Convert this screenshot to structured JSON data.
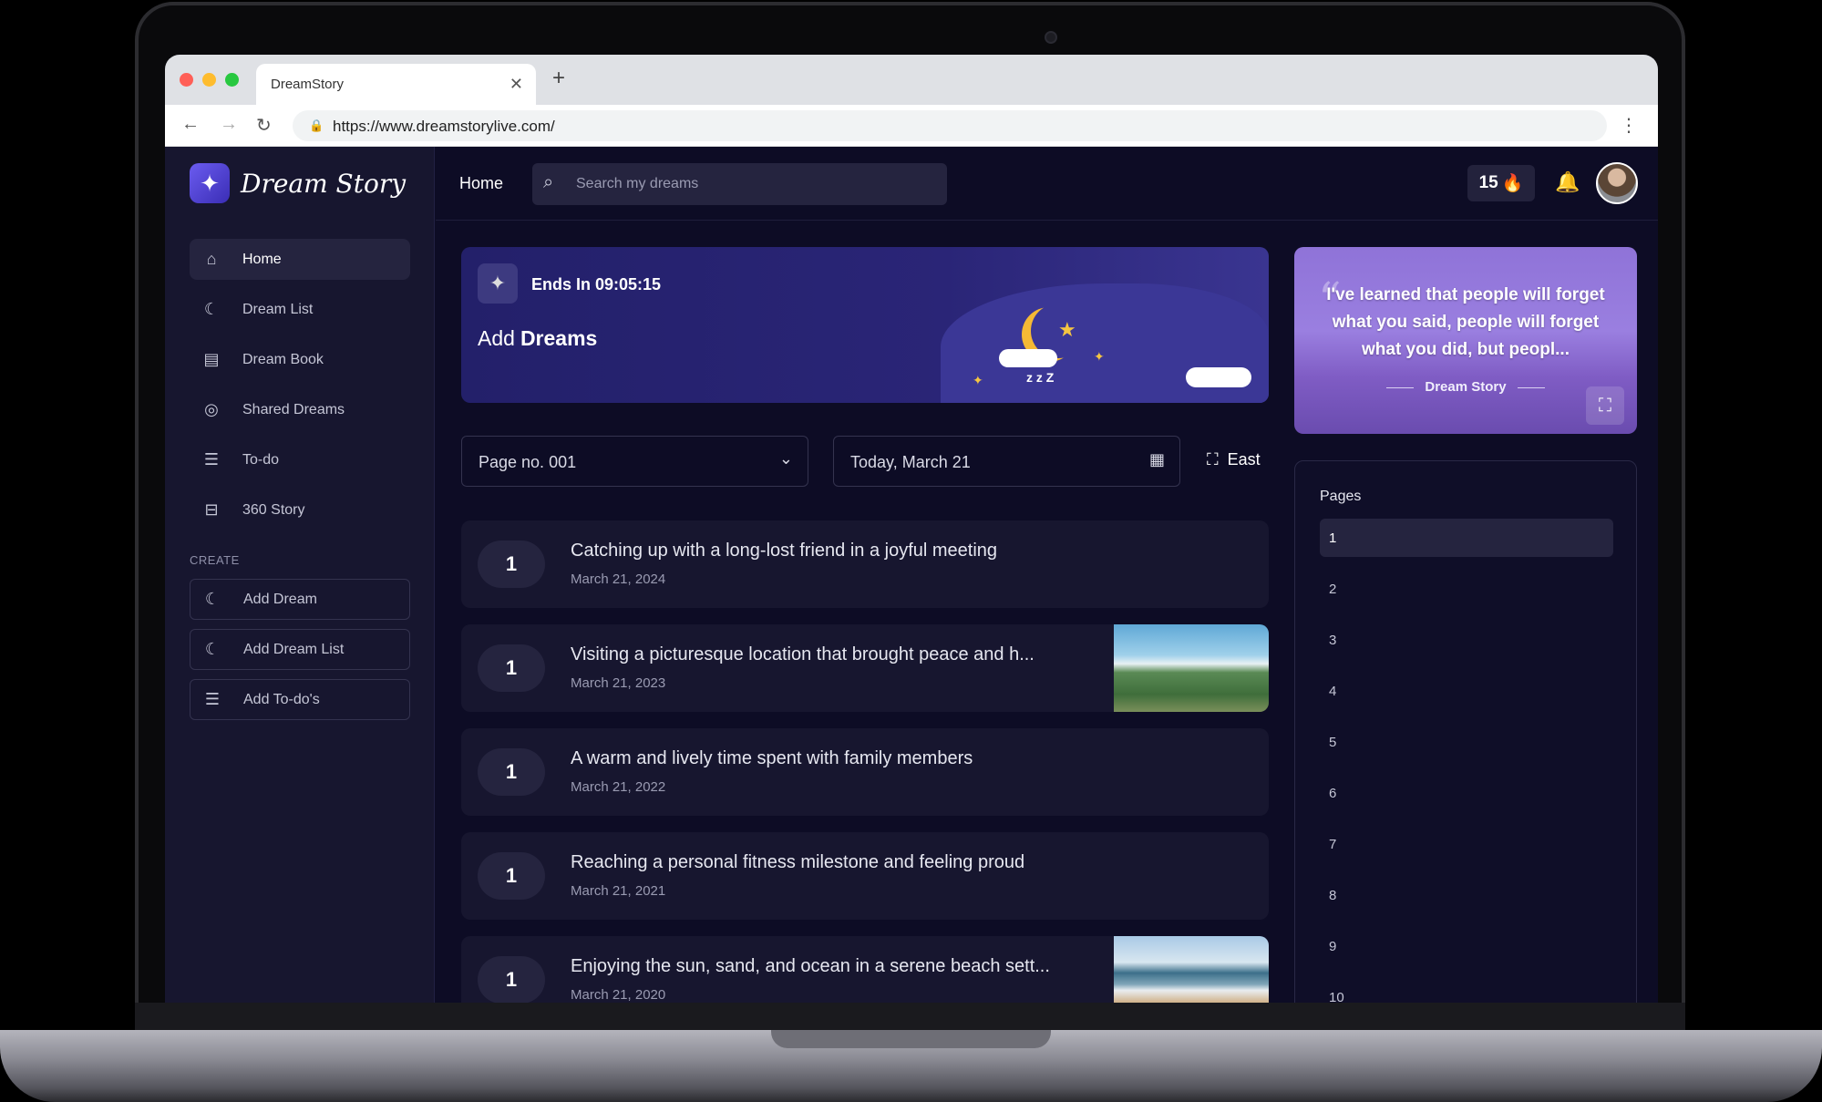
{
  "browser": {
    "tab_title": "DreamStory",
    "url": "https://www.dreamstorylive.com/"
  },
  "brand": {
    "name": "Dream Story",
    "accent": "#5b4ee6"
  },
  "sidebar": {
    "items": [
      {
        "label": "Home",
        "icon": "home-icon",
        "active": true
      },
      {
        "label": "Dream List",
        "icon": "moon-outline-icon"
      },
      {
        "label": "Dream Book",
        "icon": "book-icon"
      },
      {
        "label": "Shared Dreams",
        "icon": "shared-icon"
      },
      {
        "label": "To-do",
        "icon": "list-icon"
      },
      {
        "label": "360 Story",
        "icon": "open-book-icon"
      }
    ],
    "create_label": "CREATE",
    "create_items": [
      {
        "label": "Add Dream",
        "icon": "moon-icon"
      },
      {
        "label": "Add Dream List",
        "icon": "moon-outline-icon"
      },
      {
        "label": "Add To-do's",
        "icon": "list-icon"
      }
    ]
  },
  "header": {
    "title": "Home",
    "search_placeholder": "Search my dreams",
    "streak_count": "15",
    "streak_icon": "fire-icon"
  },
  "banner": {
    "ends_label": "Ends In 09:05:15",
    "add_prefix": "Add",
    "add_bold": "Dreams"
  },
  "quote": {
    "text": "I've learned that people will forget what you said, people will forget what you did, but peopl...",
    "author": "Dream Story"
  },
  "filters": {
    "page_select": "Page no. 001",
    "date": "Today, March 21",
    "east_label": "East"
  },
  "dreams": [
    {
      "num": "1",
      "title": "Catching up with a long-lost friend in a joyful meeting",
      "date": "March 21, 2024",
      "image": null
    },
    {
      "num": "1",
      "title": "Visiting a picturesque location that brought peace and h...",
      "date": "March 21, 2023",
      "image": "mountain"
    },
    {
      "num": "1",
      "title": "A warm and lively time spent with family members",
      "date": "March 21, 2022",
      "image": null
    },
    {
      "num": "1",
      "title": "Reaching a personal fitness milestone and feeling proud",
      "date": "March 21, 2021",
      "image": null
    },
    {
      "num": "1",
      "title": "Enjoying the sun, sand, and ocean in a serene beach sett...",
      "date": "March 21, 2020",
      "image": "beach"
    }
  ],
  "pages": {
    "title": "Pages",
    "items": [
      "1",
      "2",
      "3",
      "4",
      "5",
      "6",
      "7",
      "8",
      "9",
      "10"
    ],
    "active": "1"
  }
}
